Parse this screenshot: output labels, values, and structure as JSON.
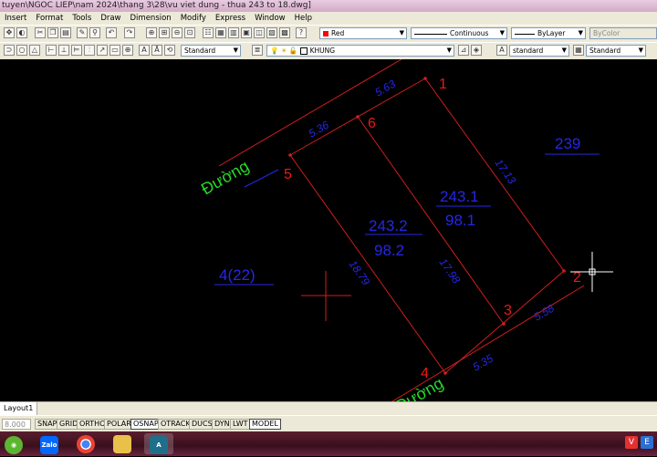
{
  "window": {
    "title": "tuyen\\NGOC LIEP\\nam 2024\\thang 3\\28\\vu viet dung - thua 243 to 18.dwg]"
  },
  "menu": [
    "Insert",
    "Format",
    "Tools",
    "Draw",
    "Dimension",
    "Modify",
    "Express",
    "Window",
    "Help"
  ],
  "toolbar1": {
    "color": "Red",
    "color_hex": "#ff0000",
    "linetype": "Continuous",
    "lineweight": "ByLayer",
    "plotstyle": "ByColor"
  },
  "toolbar2": {
    "text_style": "Standard",
    "layer": "KHUNG",
    "dim_style": "standard",
    "table_style": "Standard"
  },
  "drawing": {
    "road_labels": [
      "Đường",
      "Đường"
    ],
    "points": [
      "1",
      "2",
      "3",
      "4",
      "5",
      "6"
    ],
    "parcel_239": "239",
    "parcel_422": "4(22)",
    "parcel_2431_id": "243.1",
    "parcel_2431_area": "98.1",
    "parcel_2432_id": "243.2",
    "parcel_2432_area": "98.2",
    "dims": {
      "d_563": "5.63",
      "d_536": "5.36",
      "d_1713": "17.13",
      "d_1798": "17.98",
      "d_1879": "18.79",
      "d_558": "5.58",
      "d_535": "5.35"
    },
    "colors": {
      "dimension": "#2626e8",
      "point": "#e81a1a",
      "road": "#2ad82a",
      "line": "#d21e1e"
    }
  },
  "layout_tab": "Layout1",
  "status": {
    "coords": "8.000",
    "buttons": [
      "SNAP",
      "GRID",
      "ORTHO",
      "POLAR",
      "OSNAP",
      "OTRACK",
      "DUCS",
      "DYN",
      "LWT",
      "MODEL"
    ],
    "active": [
      "OSNAP",
      "MODEL"
    ]
  },
  "taskbar": {
    "apps": [
      "Zalo",
      "Chrome",
      "File Explorer",
      "AutoCAD"
    ],
    "tray_letters": [
      "V",
      "E"
    ]
  }
}
